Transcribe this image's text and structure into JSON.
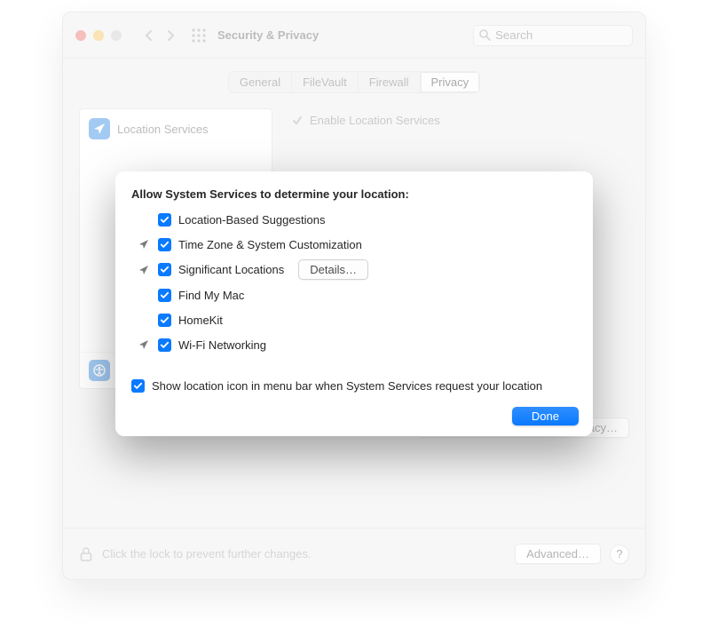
{
  "titlebar": {
    "title": "Security & Privacy"
  },
  "search": {
    "placeholder": "Search"
  },
  "tabs": {
    "items": [
      "General",
      "FileVault",
      "Firewall",
      "Privacy"
    ],
    "active": "Privacy"
  },
  "sidebar": {
    "location": "Location Services",
    "accessibility": "Accessibility"
  },
  "right": {
    "enable": "Enable Location Services",
    "about": "About Location Services & Privacy…"
  },
  "footer": {
    "lock_text": "Click the lock to prevent further changes.",
    "advanced": "Advanced…",
    "help": "?"
  },
  "sheet": {
    "heading": "Allow System Services to determine your location:",
    "options": [
      {
        "arrow": false,
        "label": "Location-Based Suggestions",
        "details": false
      },
      {
        "arrow": true,
        "label": "Time Zone & System Customization",
        "details": false
      },
      {
        "arrow": true,
        "label": "Significant Locations",
        "details": true
      },
      {
        "arrow": false,
        "label": "Find My Mac",
        "details": false
      },
      {
        "arrow": false,
        "label": "HomeKit",
        "details": false
      },
      {
        "arrow": true,
        "label": "Wi-Fi Networking",
        "details": false
      }
    ],
    "details_label": "Details…",
    "menubar": "Show location icon in menu bar when System Services request your location",
    "done": "Done"
  },
  "colors": {
    "accent": "#0a7aff"
  }
}
